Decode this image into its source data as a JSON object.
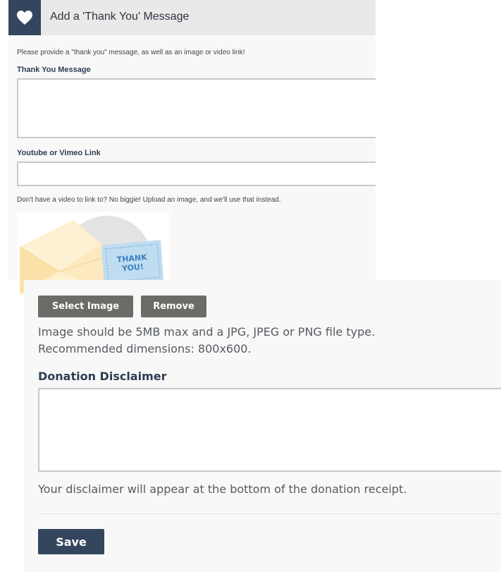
{
  "header": {
    "title": "Add a 'Thank You' Message",
    "icon": "heart-icon",
    "accent_color": "#34465d"
  },
  "intro": "Please provide a \"thank you\" message, as well as an image or video link!",
  "thank_you_message": {
    "label": "Thank You Message",
    "value": ""
  },
  "video_link": {
    "label": "Youtube or Vimeo Link",
    "value": ""
  },
  "upload_hint": "Don't have a video to link to? No biggie! Upload an image, and we'll use that instead.",
  "image_preview": {
    "card_text_line1": "THANK",
    "card_text_line2": "YOU!"
  },
  "image_buttons": {
    "select": "Select Image",
    "remove": "Remove"
  },
  "image_requirements": {
    "line1": "Image should be 5MB max and a JPG, JPEG or PNG file type.",
    "line2": "Recommended dimensions: 800x600."
  },
  "donation_disclaimer": {
    "label": "Donation Disclaimer",
    "value": "",
    "note": "Your disclaimer will appear at the bottom of the donation receipt."
  },
  "save_label": "Save"
}
